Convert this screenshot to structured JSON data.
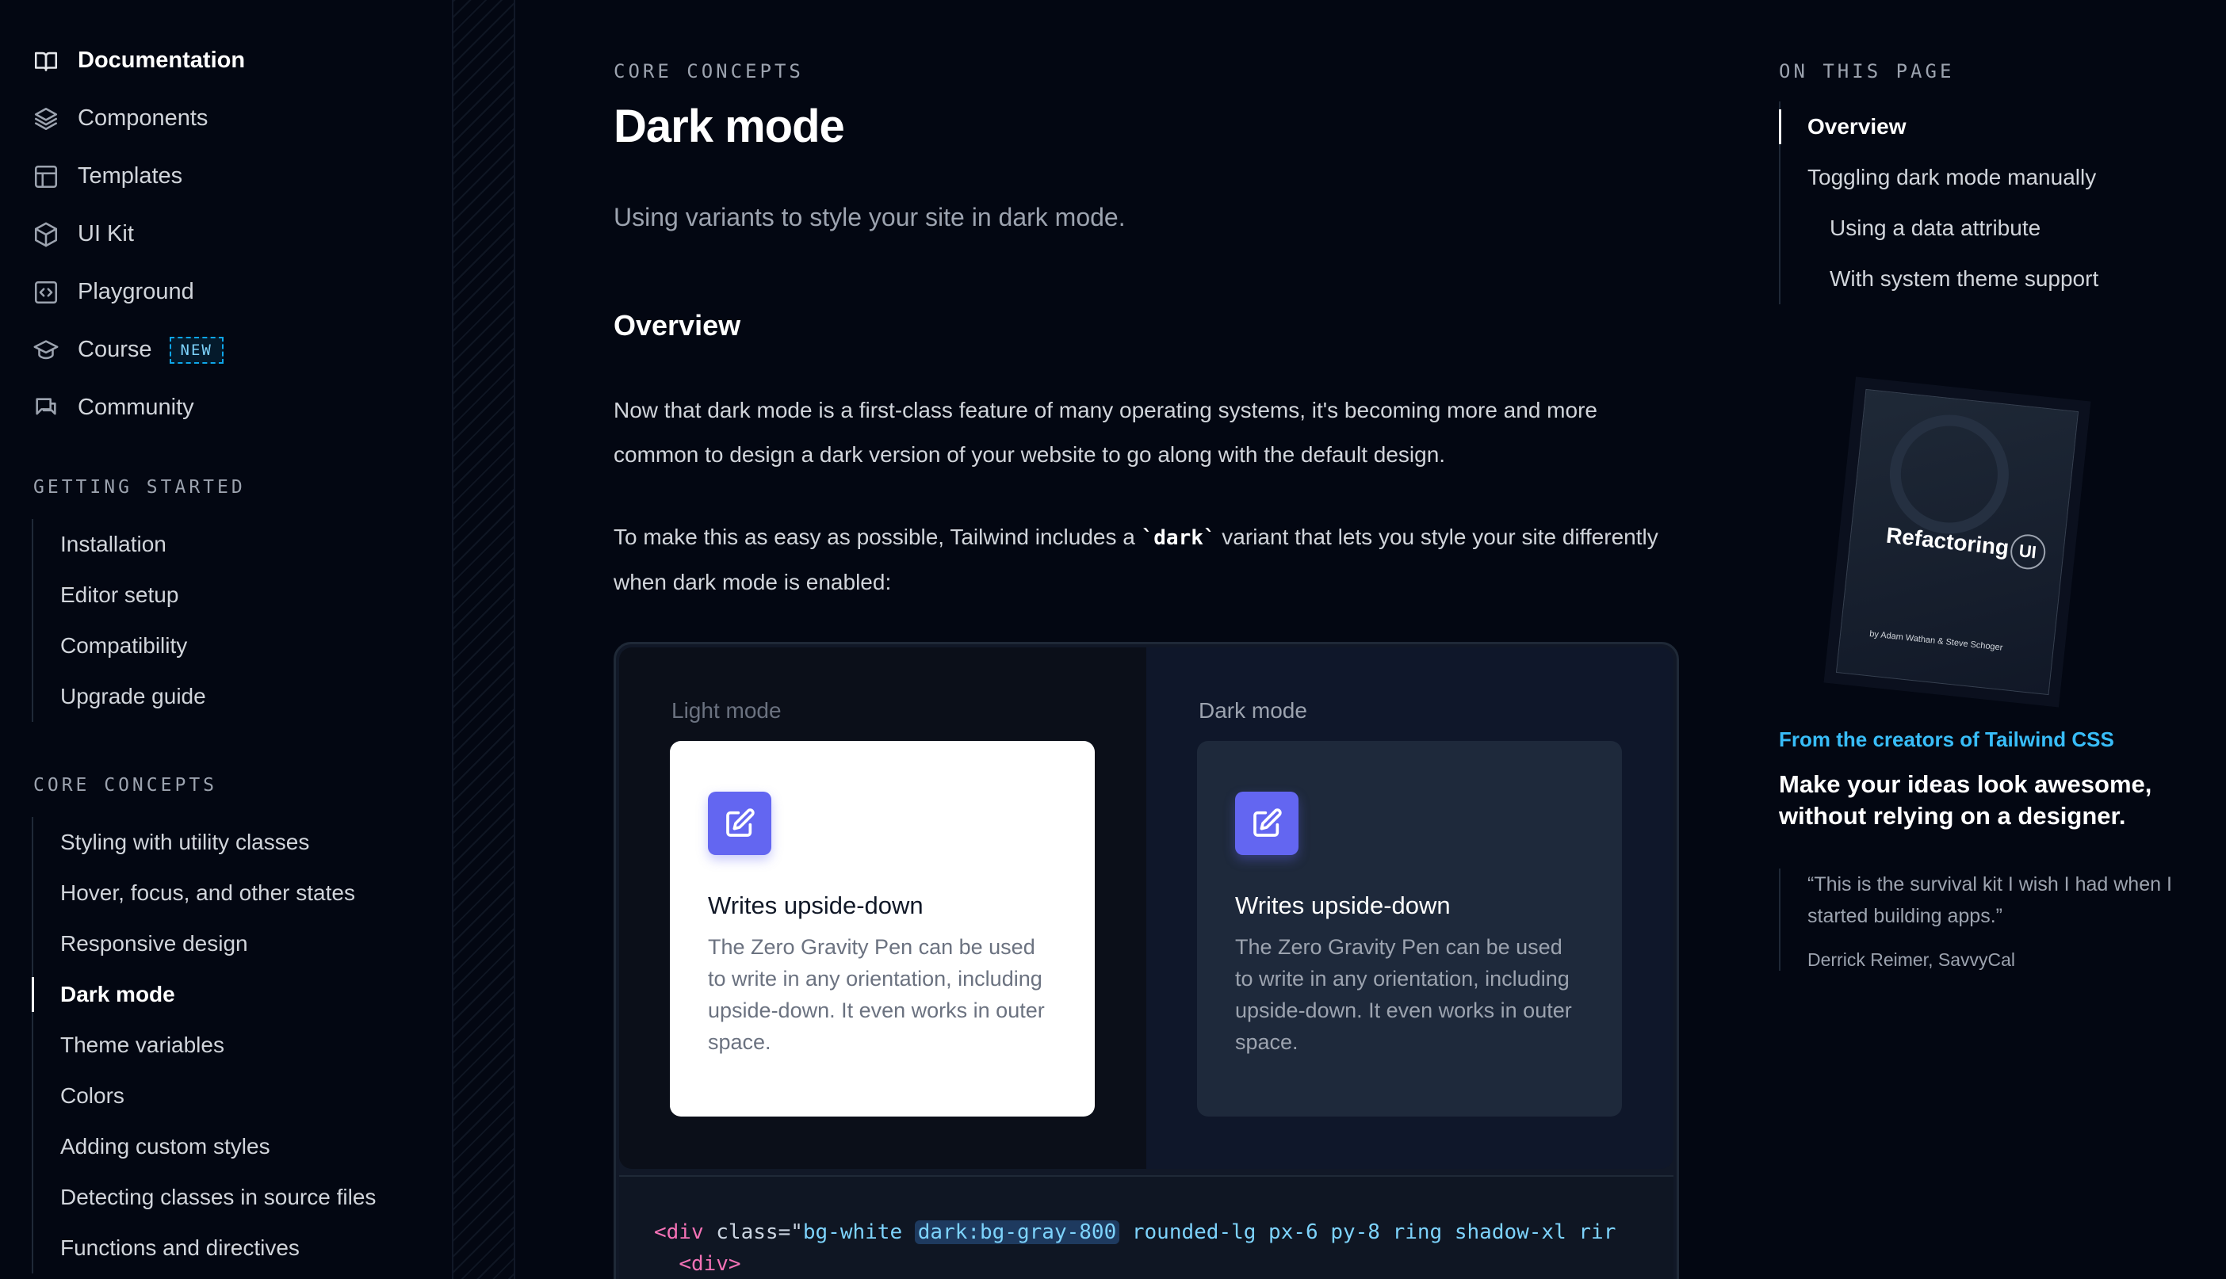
{
  "sidebar": {
    "primary": [
      {
        "label": "Documentation",
        "icon": "book-icon"
      },
      {
        "label": "Components",
        "icon": "layers-icon"
      },
      {
        "label": "Templates",
        "icon": "layout-icon"
      },
      {
        "label": "UI Kit",
        "icon": "cube-icon"
      },
      {
        "label": "Playground",
        "icon": "code-icon"
      },
      {
        "label": "Course",
        "icon": "graduation-cap-icon",
        "badge": "NEW"
      },
      {
        "label": "Community",
        "icon": "chat-icon"
      }
    ],
    "getting_started": {
      "heading": "GETTING STARTED",
      "items": [
        "Installation",
        "Editor setup",
        "Compatibility",
        "Upgrade guide"
      ]
    },
    "core_concepts": {
      "heading": "CORE CONCEPTS",
      "items": [
        "Styling with utility classes",
        "Hover, focus, and other states",
        "Responsive design",
        "Dark mode",
        "Theme variables",
        "Colors",
        "Adding custom styles",
        "Detecting classes in source files",
        "Functions and directives"
      ],
      "active": "Dark mode"
    }
  },
  "main": {
    "eyebrow": "CORE CONCEPTS",
    "title": "Dark mode",
    "lead": "Using variants to style your site in dark mode.",
    "overview_heading": "Overview",
    "para1": "Now that dark mode is a first-class feature of many operating systems, it's becoming more and more common to design a dark version of your website to go along with the default design.",
    "para2_before": "To make this as easy as possible, Tailwind includes a ",
    "para2_code": "`dark`",
    "para2_after": " variant that lets you style your site differently when dark mode is enabled:",
    "example": {
      "light_label": "Light mode",
      "dark_label": "Dark mode",
      "card_title": "Writes upside-down",
      "card_desc": "The Zero Gravity Pen can be used to write in any orientation, including upside-down. It even works in outer space.",
      "card_icon": "pencil-square-icon",
      "code": {
        "tag_open": "<div",
        "attr": "class",
        "eq_quote": "=\"",
        "cls1": "bg-white",
        "cls_hl": "dark:bg-gray-800",
        "cls_rest": "rounded-lg px-6 py-8 ring shadow-xl rir",
        "line2": "<div>"
      }
    }
  },
  "aside": {
    "toc_title": "ON THIS PAGE",
    "toc": [
      {
        "label": "Overview",
        "level": 1,
        "active": true
      },
      {
        "label": "Toggling dark mode manually",
        "level": 1
      },
      {
        "label": "Using a data attribute",
        "level": 2
      },
      {
        "label": "With system theme support",
        "level": 2
      }
    ],
    "book": {
      "title": "Refactoring",
      "title_ui": "UI",
      "authors": "by Adam Wathan & Steve Schoger"
    },
    "promo_kicker": "From the creators of Tailwind CSS",
    "promo_head": "Make your ideas look awesome, without relying on a designer.",
    "quote": "“This is the survival kit I wish I had when I started building apps.”",
    "quote_author": "Derrick Reimer, SavvyCal"
  },
  "colors": {
    "background": "#030712",
    "accent": "#6366f1",
    "link": "#38bdf8"
  }
}
